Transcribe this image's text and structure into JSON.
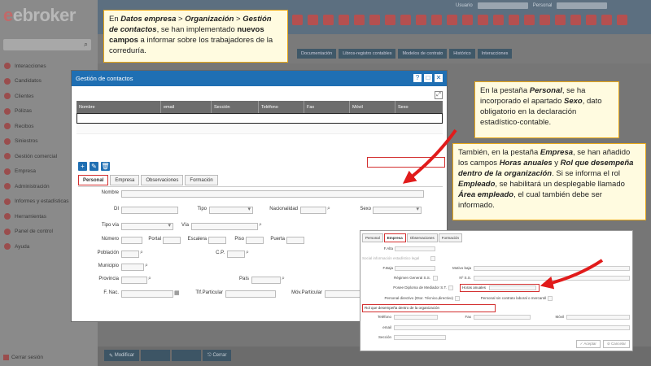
{
  "app": {
    "logo": "ebroker"
  },
  "sidebar": {
    "items": [
      {
        "label": "Interacciones"
      },
      {
        "label": "Candidatos"
      },
      {
        "label": "Clientes"
      },
      {
        "label": "Pólizas"
      },
      {
        "label": "Recibos"
      },
      {
        "label": "Siniestros"
      },
      {
        "label": "Gestión comercial"
      },
      {
        "label": "Empresa"
      },
      {
        "label": "Administración"
      },
      {
        "label": "Informes y estadísticas"
      },
      {
        "label": "Herramientas"
      },
      {
        "label": "Panel de control"
      },
      {
        "label": "Ayuda"
      }
    ],
    "logout": "Cerrar sesión"
  },
  "topbar": {
    "usuario": "Usuario",
    "personal": "Personal"
  },
  "doc_tabs": [
    "Documentación",
    "Libros-registro contables",
    "Modelos de contrato",
    "Histórico",
    "Interacciones"
  ],
  "bottom": {
    "modificar": "Modificar",
    "cerrar": "Cerrar"
  },
  "dialog": {
    "title": "Gestión de contactos",
    "buttons": [
      "?",
      "□",
      "✕"
    ],
    "grid_headers": [
      "Nombre",
      "email",
      "Sección",
      "Teléfono",
      "Fax",
      "Móvil",
      "Sexo"
    ],
    "tabs": [
      "Personal",
      "Empresa",
      "Observaciones",
      "Formación"
    ],
    "form": {
      "nombre": "Nombre",
      "di": "DI",
      "tipo": "Tipo",
      "nacionalidad": "Nacionalidad",
      "sexo": "Sexo",
      "tipo_via": "Tipo vía",
      "via": "Vía",
      "numero": "Número",
      "portal": "Portal",
      "escalera": "Escalera",
      "piso": "Piso",
      "puerta": "Puerta",
      "poblacion": "Población",
      "cp": "C.P.",
      "municipio": "Municipio",
      "provincia": "Provincia",
      "pais": "País",
      "f_nac": "F. Nac.",
      "tlf_particular": "Tlf.Particular",
      "movil_particular": "Móv.Particular"
    }
  },
  "callouts": {
    "c1": {
      "p1": "En ",
      "b1": "Datos empresa",
      "p2": " > ",
      "b2": "Organización",
      "p3": " > ",
      "b3": "Gestión de contactos",
      "p4": ", se han implementado ",
      "b4": "nuevos campos",
      "p5": " a informar sobre los trabajadores de la correduría."
    },
    "c2": {
      "p1": "En la pestaña ",
      "b1": "Personal",
      "p2": ", se ha incorporado el apartado ",
      "b2": "Sexo",
      "p3": ", dato obligatorio en la declaración estadístico-contable."
    },
    "c3": {
      "p1": "También, en la pestaña ",
      "b1": "Empresa",
      "p2": ", se han añadido los campos ",
      "b2": "Horas anuales",
      "p3": " y ",
      "b3": "Rol que desempeña dentro de la organización",
      "p4": ". Si se informa el rol ",
      "b4": "Empleado",
      "p5": ", se habilitará un desplegable llamado ",
      "b5": "Área empleado",
      "p6": ", el cual también debe ser informado."
    }
  },
  "empresa_panel": {
    "tabs": [
      "Personal",
      "Empresa",
      "Observaciones",
      "Formación"
    ],
    "f_alta": "F.Alta",
    "social": "Social información estadístico legal",
    "f_baja": "F.Baja",
    "motivo_baja": "Motivo baja",
    "regimen": "Régimen General S.S.",
    "nss": "Nº S.S.",
    "posee": "Posee Diploma de Mediador S.T.",
    "horas": "Horas anuales",
    "personal_dir": "Personal directivo (Dtor. Técnico,directivo)",
    "personal_contrato": "Personal sin contrato laboral o mercantil",
    "rol": "Rol que desempeña dentro de la organización",
    "telefono": "Teléfono",
    "fax": "Fax",
    "movil": "Móvil",
    "email": "email",
    "seccion": "Sección",
    "aceptar": "Aceptar",
    "cancelar": "Cancelar"
  },
  "colors": {
    "accent": "#1f6fb3",
    "highlight": "#d32f2f",
    "callout_bg": "#fffbe0"
  }
}
